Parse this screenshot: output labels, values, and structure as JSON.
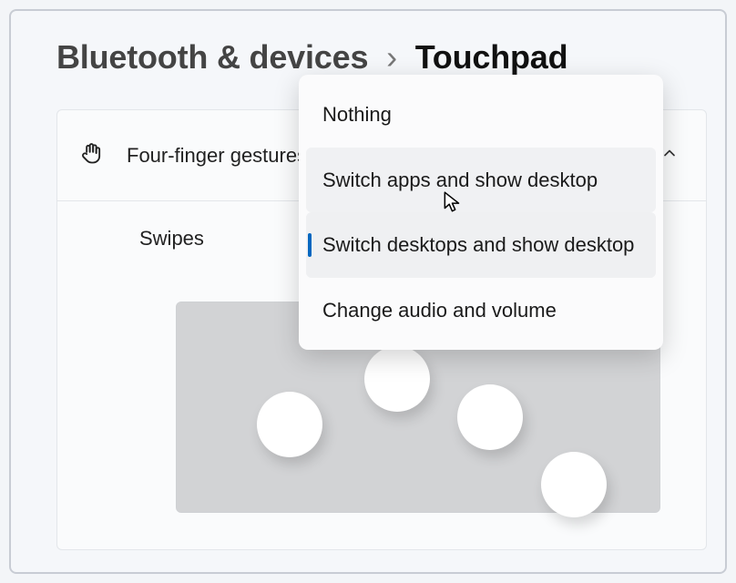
{
  "breadcrumb": {
    "category": "Bluetooth & devices",
    "separator": "›",
    "page": "Touchpad"
  },
  "section": {
    "title": "Four-finger gestures"
  },
  "swipes_label": "Swipes",
  "dropdown": {
    "options": [
      {
        "label": "Nothing",
        "selected": false,
        "hover": false
      },
      {
        "label": "Switch apps and show desktop",
        "selected": false,
        "hover": true
      },
      {
        "label": "Switch desktops and show desktop",
        "selected": true,
        "hover": false
      },
      {
        "label": "Change audio and volume",
        "selected": false,
        "hover": false
      }
    ]
  }
}
